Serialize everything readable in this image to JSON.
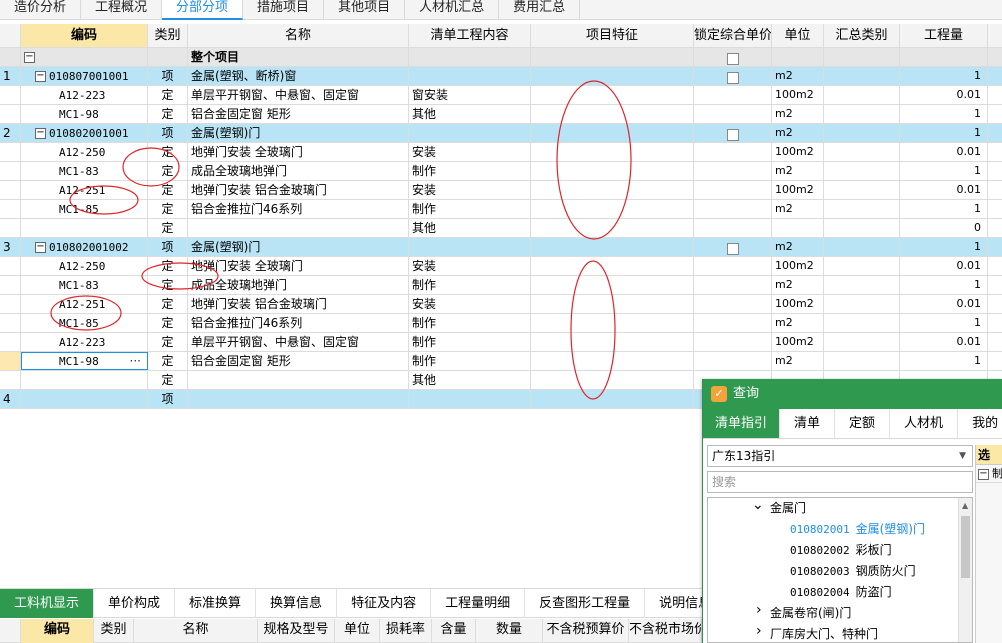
{
  "tabs": [
    "造价分析",
    "工程概况",
    "分部分项",
    "措施项目",
    "其他项目",
    "人材机汇总",
    "费用汇总"
  ],
  "active_tab": "分部分项",
  "columns": {
    "code": "编码",
    "type": "类别",
    "name": "名称",
    "content": "清单工程内容",
    "feature": "项目特征",
    "lock": "锁定综合单价",
    "unit": "单位",
    "category": "汇总类别",
    "qty": "工程量"
  },
  "whole_row": {
    "name": "整个项目"
  },
  "rows": [
    {
      "num": "1",
      "code": "010807001001",
      "type": "项",
      "name": "金属(塑钢、断桥)窗",
      "content": "",
      "unit": "m2",
      "qty": "1"
    },
    {
      "num": "",
      "code": "A12-223",
      "type": "定",
      "name": "单层平开钢窗、中悬窗、固定窗",
      "content": "窗安装",
      "unit": "100m2",
      "qty": "0.01"
    },
    {
      "num": "",
      "code": "MC1-98",
      "type": "定",
      "name": "铝合金固定窗 矩形",
      "content": "其他",
      "unit": "m2",
      "qty": "1"
    },
    {
      "num": "2",
      "code": "010802001001",
      "type": "项",
      "name": "金属(塑钢)门",
      "content": "",
      "unit": "m2",
      "qty": "1"
    },
    {
      "num": "",
      "code": "A12-250",
      "type": "定",
      "name": "地弹门安装 全玻璃门",
      "content": "安装",
      "unit": "100m2",
      "qty": "0.01"
    },
    {
      "num": "",
      "code": "MC1-83",
      "type": "定",
      "name": "成品全玻璃地弹门",
      "content": "制作",
      "unit": "m2",
      "qty": "1"
    },
    {
      "num": "",
      "code": "A12-251",
      "type": "定",
      "name": "地弹门安装 铝合金玻璃门",
      "content": "安装",
      "unit": "100m2",
      "qty": "0.01"
    },
    {
      "num": "",
      "code": "MC1-85",
      "type": "定",
      "name": "铝合金推拉门46系列",
      "content": "制作",
      "unit": "m2",
      "qty": "1"
    },
    {
      "num": "",
      "code": "",
      "type": "定",
      "name": "",
      "content": "其他",
      "unit": "",
      "qty": "0"
    },
    {
      "num": "3",
      "code": "010802001002",
      "type": "项",
      "name": "金属(塑钢)门",
      "content": "",
      "unit": "m2",
      "qty": "1"
    },
    {
      "num": "",
      "code": "A12-250",
      "type": "定",
      "name": "地弹门安装 全玻璃门",
      "content": "安装",
      "unit": "100m2",
      "qty": "0.01"
    },
    {
      "num": "",
      "code": "MC1-83",
      "type": "定",
      "name": "成品全玻璃地弹门",
      "content": "制作",
      "unit": "m2",
      "qty": "1"
    },
    {
      "num": "",
      "code": "A12-251",
      "type": "定",
      "name": "地弹门安装 铝合金玻璃门",
      "content": "安装",
      "unit": "100m2",
      "qty": "0.01"
    },
    {
      "num": "",
      "code": "MC1-85",
      "type": "定",
      "name": "铝合金推拉门46系列",
      "content": "制作",
      "unit": "m2",
      "qty": "1"
    },
    {
      "num": "",
      "code": "A12-223",
      "type": "定",
      "name": "单层平开钢窗、中悬窗、固定窗",
      "content": "制作",
      "unit": "100m2",
      "qty": "0.01"
    },
    {
      "num": "",
      "code": "MC1-98",
      "type": "定",
      "name": "铝合金固定窗 矩形",
      "content": "制作",
      "unit": "m2",
      "qty": "1"
    },
    {
      "num": "",
      "code": "",
      "type": "定",
      "name": "",
      "content": "其他",
      "unit": "",
      "qty": ""
    },
    {
      "num": "4",
      "code": "",
      "type": "项",
      "name": "",
      "content": "",
      "unit": "",
      "qty": ""
    }
  ],
  "bottom_tabs": [
    "工料机显示",
    "单价构成",
    "标准换算",
    "换算信息",
    "特征及内容",
    "工程量明细",
    "反查图形工程量",
    "说明信息"
  ],
  "bottom_columns": [
    "编码",
    "类别",
    "名称",
    "规格及型号",
    "单位",
    "损耗率",
    "含量",
    "数量",
    "不含税预算价",
    "不含税市场价"
  ],
  "dialog": {
    "title": "查询",
    "tabs": [
      "清单指引",
      "清单",
      "定额",
      "人材机",
      "我的"
    ],
    "guide_select": "广东13指引",
    "search_placeholder": "搜索",
    "tree": [
      {
        "label": "金属门",
        "toggle": "⌄",
        "level": 1
      },
      {
        "code": "010802001",
        "label": "金属(塑钢)门",
        "level": 2,
        "highlight": true
      },
      {
        "code": "010802002",
        "label": "彩板门",
        "level": 2
      },
      {
        "code": "010802003",
        "label": "钢质防火门",
        "level": 2
      },
      {
        "code": "010802004",
        "label": "防盗门",
        "level": 2
      },
      {
        "label": "金属卷帘(闸)门",
        "toggle": "›",
        "level": 1
      },
      {
        "label": "厂库房大门、特种门",
        "toggle": "›",
        "level": 1
      }
    ],
    "right_header": "选",
    "right_rows": [
      "制"
    ]
  },
  "colors": {
    "accent": "#1e8ee6",
    "green": "#2f9a4f",
    "selected_row": "#b8e4f5",
    "annotation": "#e0242a"
  }
}
